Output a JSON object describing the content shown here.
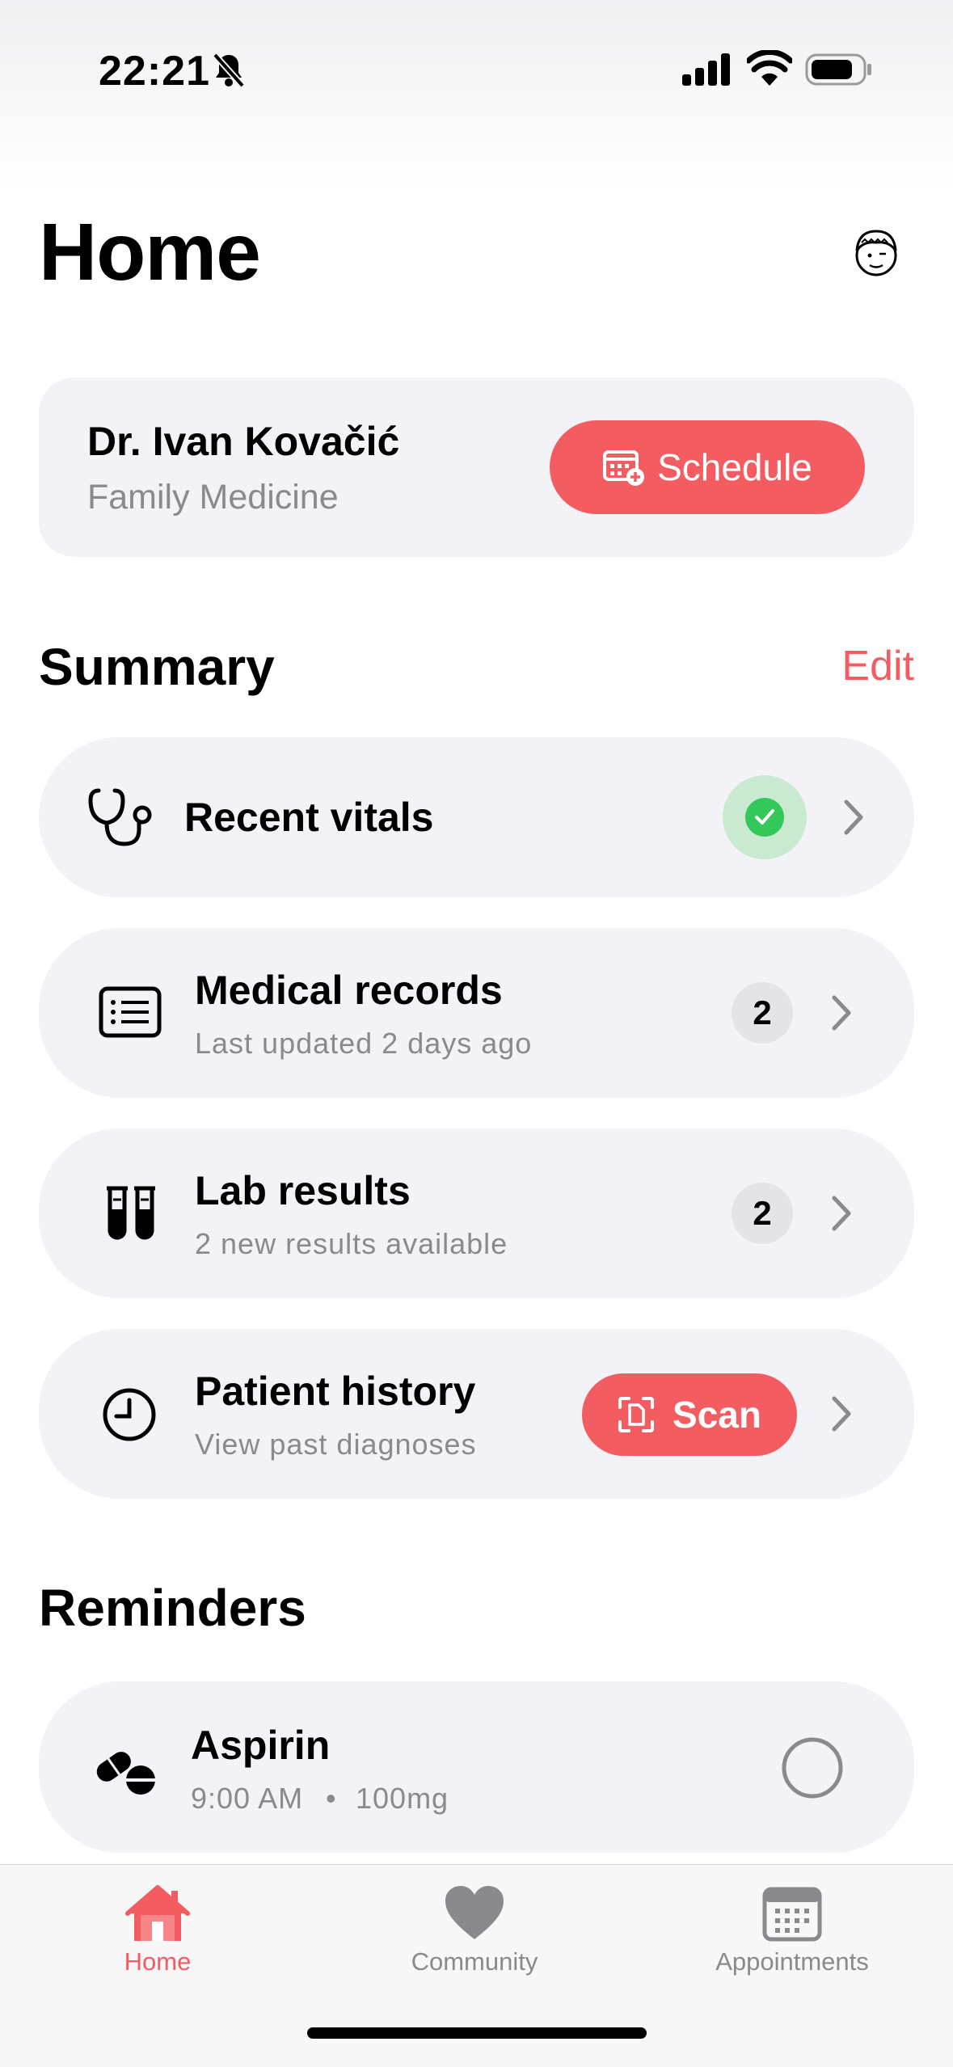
{
  "status_bar": {
    "time": "22:21"
  },
  "header": {
    "title": "Home"
  },
  "doctor": {
    "name": "Dr. Ivan Kovačić",
    "specialty": "Family Medicine",
    "schedule_label": "Schedule"
  },
  "summary": {
    "title": "Summary",
    "edit_label": "Edit",
    "items": [
      {
        "title": "Recent vitals"
      },
      {
        "title": "Medical records",
        "subtitle": "Last updated 2 days ago",
        "count": "2"
      },
      {
        "title": "Lab results",
        "subtitle": "2 new results available",
        "count": "2"
      },
      {
        "title": "Patient history",
        "subtitle": "View past diagnoses",
        "scan_label": "Scan"
      }
    ]
  },
  "reminders": {
    "title": "Reminders",
    "items": [
      {
        "name": "Aspirin",
        "time": "9:00 AM",
        "separator": "•",
        "dose": "100mg"
      }
    ]
  },
  "tab_bar": {
    "tabs": [
      {
        "label": "Home"
      },
      {
        "label": "Community"
      },
      {
        "label": "Appointments"
      }
    ]
  },
  "colors": {
    "accent": "#f35d61",
    "success": "#34c759",
    "card_bg": "#f2f2f7",
    "secondary_text": "#8a8a8e"
  },
  "icons": [
    "bell-slash-icon",
    "signal-icon",
    "wifi-icon",
    "battery-icon",
    "avatar",
    "calendar-plus-icon",
    "stethoscope-icon",
    "checkmark-icon",
    "chevron-right-icon",
    "document-list-icon",
    "test-tubes-icon",
    "clock-icon",
    "scan-document-icon",
    "pills-icon",
    "circle-icon",
    "house-icon",
    "heart-icon",
    "calendar-icon"
  ]
}
